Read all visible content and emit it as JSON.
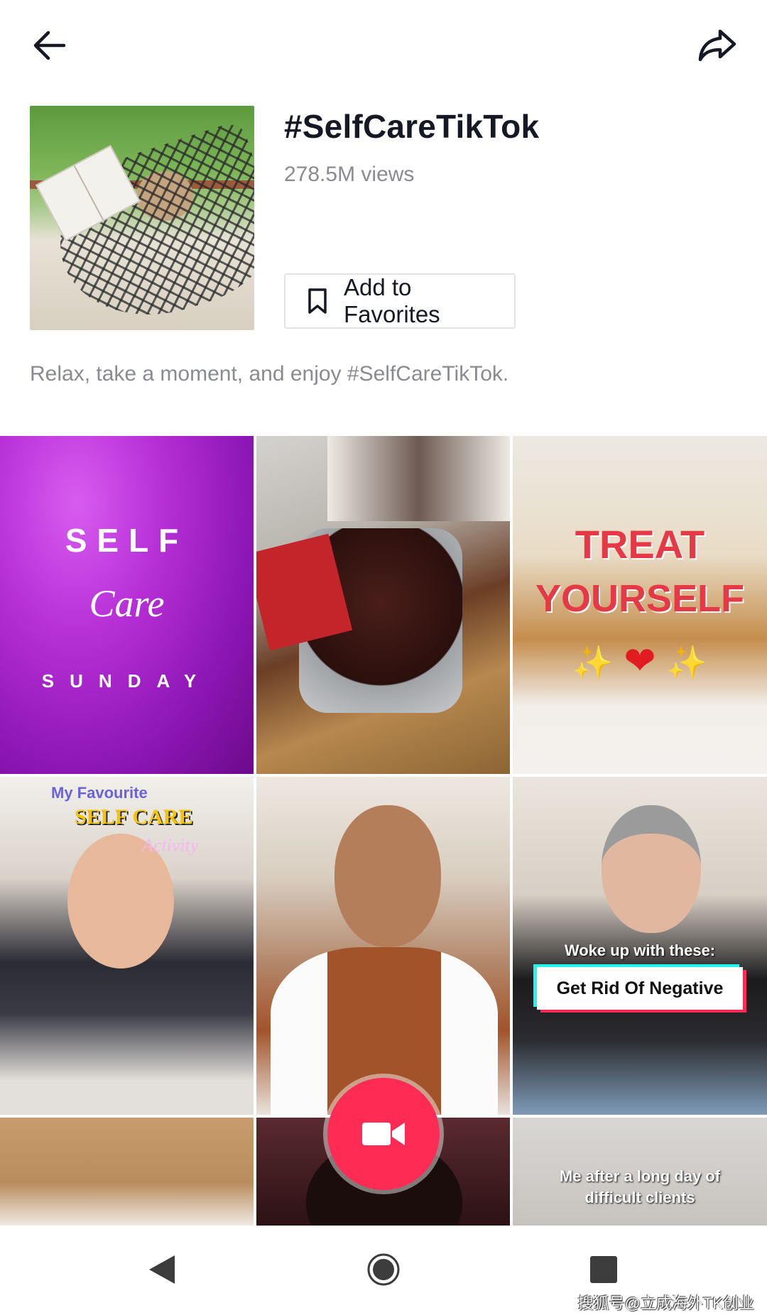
{
  "top_bar": {
    "back_icon": "arrow-left-icon",
    "share_icon": "share-arrow-icon"
  },
  "hashtag": {
    "title": "#SelfCareTikTok",
    "views": "278.5M views",
    "favorites_button": "Add to Favorites",
    "favorites_icon": "bookmark-icon",
    "description": "Relax, take a moment, and enjoy #SelfCareTikTok."
  },
  "videos": [
    {
      "lines": [
        "SELF",
        "Care",
        "SUNDAY"
      ]
    },
    {
      "lines": []
    },
    {
      "lines": [
        "TREAT",
        "YOURSELF",
        "✨",
        "❤",
        "✨"
      ]
    },
    {
      "lines": [
        "My Favourite",
        "SELF CARE",
        "Activity"
      ]
    },
    {
      "lines": []
    },
    {
      "lines": [
        "Woke up with these:",
        "Get Rid Of Negative"
      ]
    },
    {
      "lines": []
    },
    {
      "lines": []
    },
    {
      "lines": [
        "Me after a long day of",
        "difficult clients"
      ]
    }
  ],
  "record_button": {
    "icon": "video-camera-icon",
    "color": "#fe2c55"
  },
  "nav_bar": {
    "back_icon": "triangle-back-icon",
    "home_icon": "circle-home-icon",
    "recents_icon": "square-recents-icon"
  },
  "watermark": "搜狐号@立成海外TK创业",
  "colors": {
    "accent": "#fe2c55",
    "text_primary": "#161823",
    "text_secondary": "#8a8b91"
  }
}
